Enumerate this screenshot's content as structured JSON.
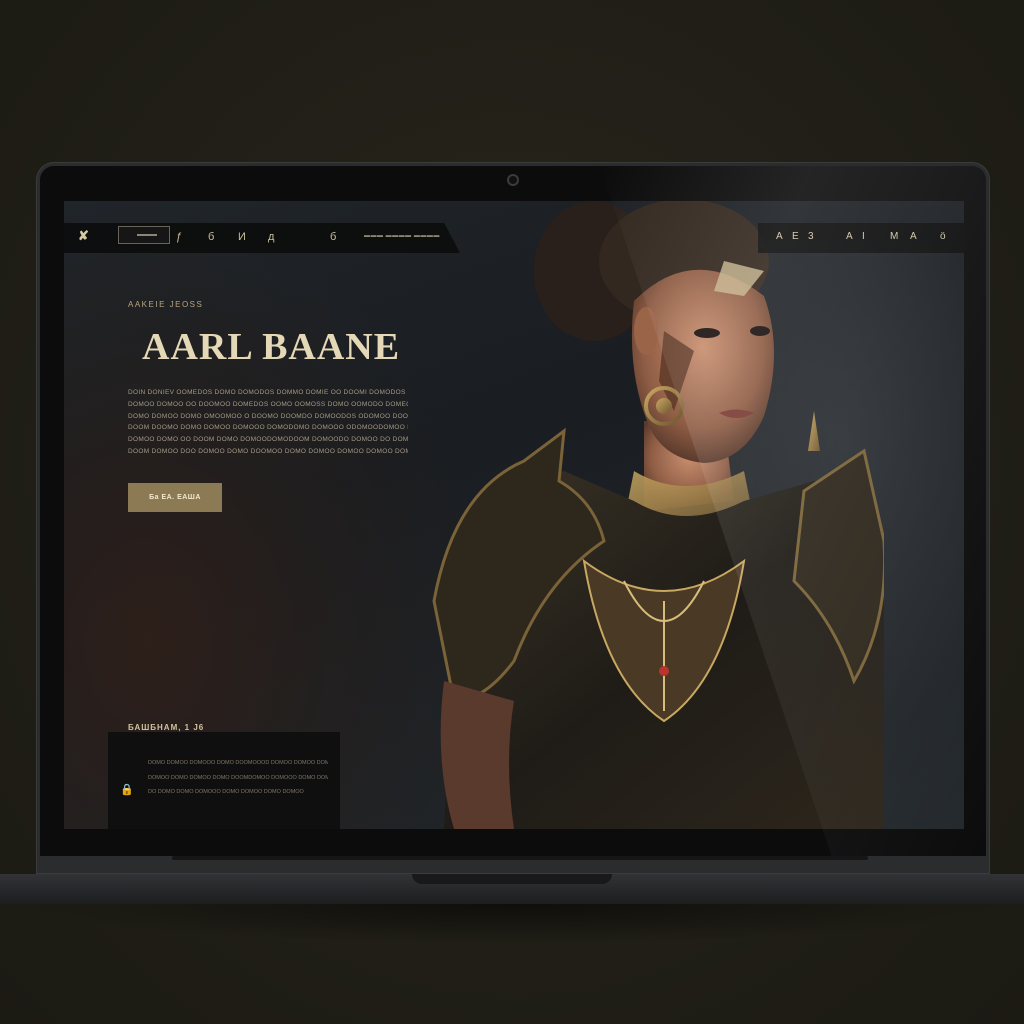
{
  "nav": {
    "logo": "✘",
    "left_items": [
      "ƒ",
      "б",
      "И",
      "д",
      "б"
    ],
    "small_text": "▬▬▬  ▬▬▬▬  ▬▬▬▬",
    "right_items": [
      "A",
      "E",
      "3",
      "A",
      "I",
      "M",
      "A",
      "ö"
    ]
  },
  "hero": {
    "subtitle": "AAKEIE  JEOSS",
    "title": "AARL BAANE",
    "body_lines": [
      "DOIN DONIEV OOMEDOS DOMO DOMODOS DOMMO DOMIE OO DOOMI DOMODOS O",
      "DOMOO DOMOO OO DOOMOO DOMEDOS OOMO OOMOSS DOMO OOMODO DOMEOE OO DOMO",
      "DOMO DOMOO DOMO OMOOMOO O DOOMO DOOMDO DOMOODOS ODOMOO DOO DOMO",
      "DOOM DOOMO DOMO DOMOO DOMOOO DOMODOMO DOMOOO ODOMOODOMOO DOMOOOO DO",
      "DOMOO DOMO OO DOOM DOMO DOMOODOMODOOM DOMOODO DOMOO DO DOMOO",
      "DOOM DOMOO DOO DOMOO DOMO DOOMOO DOMO DOMOO DOMOO DOMOO DOMOOO"
    ],
    "cta_label": "Ба ЕА. ЕАША"
  },
  "section": {
    "label": "БАШБНАМ, 1 Ј6",
    "icon": "lock-icon",
    "lines": [
      "DOMO DOMOO DOMOOO DOMO DOOMOOOD DOMOO DOMOO DOMOOO DOO",
      "DOMOO DOMO DOMOO DOMO DOOMDOMOO DOMOOO DOMO DOMOO",
      "DO DOMO DOMO DOMOOO DOMO DOMOO DOMO DOMOO"
    ]
  },
  "colors": {
    "accent_gold": "#8c7a55",
    "title": "#e4d8b6",
    "background": "#211f17"
  }
}
